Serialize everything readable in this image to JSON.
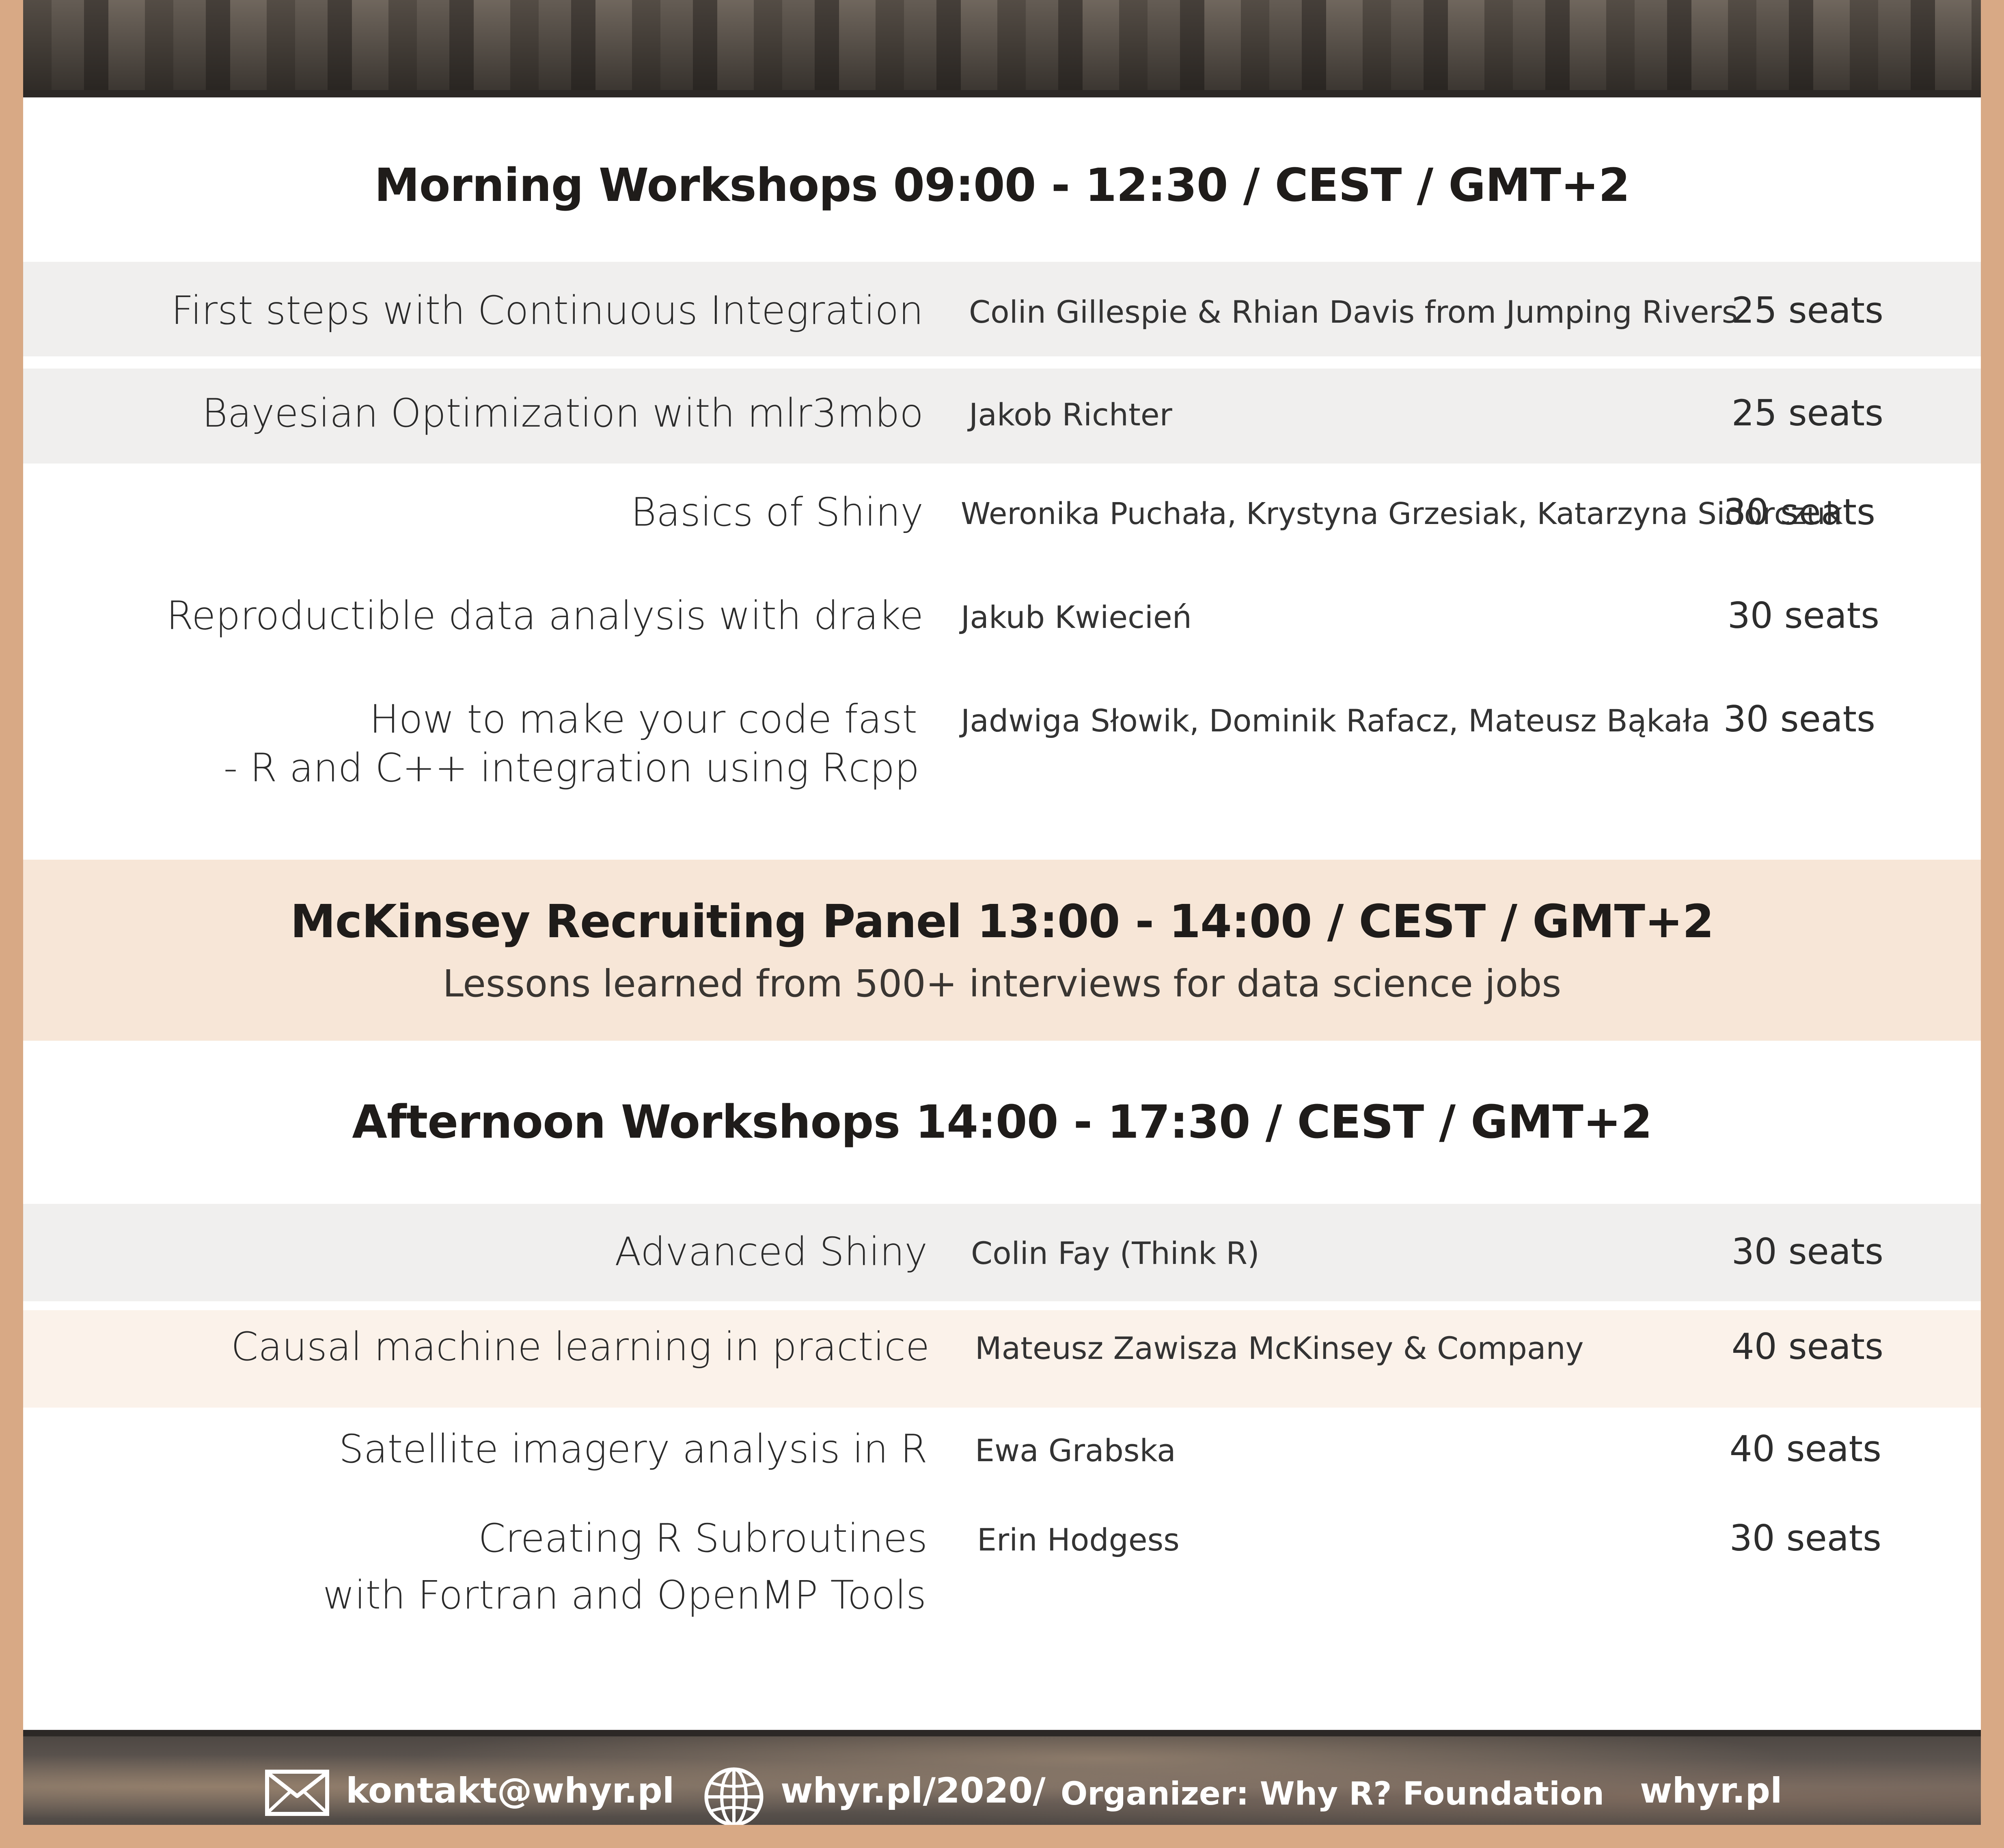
{
  "morning": {
    "title": "Morning Workshops 09:00 - 12:30 / CEST / GMT+2",
    "workshops": [
      {
        "title": "First steps with Continuous Integration",
        "host": "Colin Gillespie & Rhian Davis from Jumping Rivers",
        "seats": "25 seats"
      },
      {
        "title": "Bayesian Optimization with mlr3mbo",
        "host": "Jakob Richter",
        "seats": "25 seats"
      },
      {
        "title": "Basics of Shiny",
        "host": "Weronika Puchała, Krystyna Grzesiak, Katarzyna Sidorczuk",
        "seats": "30 seats"
      },
      {
        "title": "Reproductible data analysis with drake",
        "host": "Jakub Kwiecień",
        "seats": "30 seats"
      },
      {
        "title_line1": "How to make your code fast",
        "title_line2": "- R and C++ integration using Rcpp",
        "host": "Jadwiga Słowik, Dominik Rafacz, Mateusz Bąkała",
        "seats": "30 seats"
      }
    ]
  },
  "panel": {
    "title": "McKinsey Recruiting Panel 13:00 - 14:00 / CEST / GMT+2",
    "subtitle": "Lessons learned from 500+ interviews for data science jobs"
  },
  "afternoon": {
    "title": "Afternoon Workshops 14:00 - 17:30 / CEST / GMT+2",
    "workshops": [
      {
        "title": "Advanced Shiny",
        "host": "Colin Fay   (Think R)",
        "seats": "30 seats"
      },
      {
        "title": "Causal machine learning in practice",
        "host": "Mateusz Zawisza McKinsey & Company",
        "seats": "40 seats"
      },
      {
        "title": "Satellite imagery analysis in R",
        "host": "Ewa Grabska",
        "seats": "40 seats"
      },
      {
        "title_line1": "Creating R Subroutines",
        "title_line2": "with Fortran and OpenMP Tools",
        "host": "Erin Hodgess",
        "seats": "30 seats"
      }
    ]
  },
  "footer": {
    "email": "kontakt@whyr.pl",
    "website": "whyr.pl/2020/",
    "organizer": "Organizer: Why R? Foundation",
    "brand": "whyr.pl",
    "email_icon": "envelope-icon",
    "website_icon": "globe-icon"
  },
  "colors": {
    "frame": "#d8a985",
    "panel_band": "#f7e6d7",
    "row_gray": "#f0efee",
    "row_cream": "#fbf2ea"
  }
}
